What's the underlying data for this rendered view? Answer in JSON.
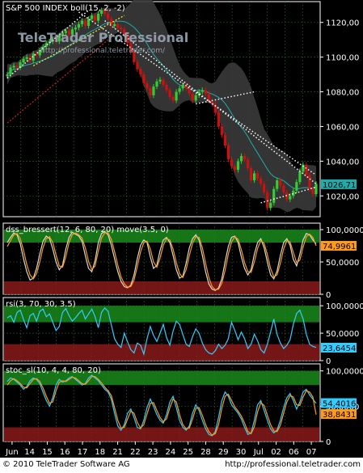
{
  "chart_data": [
    {
      "type": "candlestick",
      "title": "S&P 500 INDEX boll(15, 2, -2)",
      "watermark": "TeleTrader Professional",
      "watermark_url": "http://professional.teletrader.com/",
      "ylim": [
        1008,
        1132
      ],
      "yticks": [
        "1120,00",
        "1100,00",
        "1080,00",
        "1060,00",
        "1040,00",
        "1020,00"
      ],
      "ytick_values": [
        1120,
        1100,
        1080,
        1060,
        1040,
        1020
      ],
      "last_value": "1026,71",
      "last": 1026.71,
      "close": [
        1090,
        1094,
        1095,
        1094,
        1097,
        1099,
        1100,
        1098,
        1102,
        1101,
        1104,
        1106,
        1108,
        1109,
        1110,
        1109,
        1112,
        1114,
        1115,
        1113,
        1116,
        1117,
        1119,
        1121,
        1118,
        1122,
        1124,
        1121,
        1125,
        1127,
        1125,
        1122,
        1118,
        1119,
        1117,
        1116,
        1113,
        1108,
        1103,
        1097,
        1093,
        1090,
        1085,
        1082,
        1078,
        1083,
        1086,
        1087,
        1084,
        1081,
        1077,
        1075,
        1080,
        1082,
        1084,
        1082,
        1079,
        1075,
        1078,
        1080,
        1081,
        1079,
        1075,
        1073,
        1068,
        1060,
        1055,
        1049,
        1041,
        1037,
        1035,
        1040,
        1043,
        1041,
        1036,
        1029,
        1033,
        1030,
        1027,
        1022,
        1013,
        1016,
        1024,
        1029,
        1026,
        1022,
        1018,
        1020,
        1023,
        1028,
        1034,
        1038,
        1032,
        1024,
        1021,
        1027
      ]
    },
    {
      "type": "line",
      "title": "dss_bressert(12, 6, 80, 20) move(3.5, 0)",
      "ylim": [
        0,
        110
      ],
      "yticks": [
        "100,0000",
        "50,0000",
        "0"
      ],
      "ytick_values": [
        100,
        50,
        0
      ],
      "bands": [
        {
          "from": 80,
          "to": 100,
          "color": "#1a8a1a"
        },
        {
          "from": 0,
          "to": 20,
          "color": "#8a1a1a"
        }
      ],
      "series": [
        {
          "color": "#d9d9d9",
          "values": [
            80,
            88,
            95,
            92,
            78,
            55,
            35,
            22,
            25,
            40,
            62,
            82,
            90,
            86,
            70,
            50,
            38,
            45,
            70,
            88,
            96,
            93,
            90,
            82,
            60,
            40,
            35,
            52,
            80,
            94,
            97,
            92,
            76,
            55,
            35,
            20,
            12,
            10,
            14,
            30,
            55,
            76,
            84,
            80,
            58,
            40,
            45,
            68,
            84,
            88,
            80,
            60,
            38,
            25,
            28,
            48,
            72,
            86,
            92,
            84,
            60,
            35,
            16,
            8,
            6,
            10,
            24,
            50,
            74,
            88,
            90,
            80,
            58,
            40,
            30,
            38,
            62,
            80,
            86,
            72,
            50,
            30,
            24,
            36,
            60,
            80,
            86,
            76,
            54,
            44,
            62,
            84,
            94,
            92,
            84,
            78
          ]
        },
        {
          "color": "#ff9a1a",
          "values": [
            74,
            83,
            92,
            94,
            86,
            68,
            46,
            30,
            24,
            32,
            50,
            72,
            86,
            89,
            80,
            61,
            44,
            42,
            58,
            80,
            92,
            95,
            92,
            87,
            72,
            51,
            38,
            44,
            67,
            87,
            95,
            95,
            85,
            66,
            45,
            27,
            16,
            11,
            12,
            22,
            43,
            66,
            80,
            82,
            70,
            50,
            42,
            56,
            76,
            86,
            84,
            70,
            49,
            32,
            26,
            38,
            60,
            79,
            89,
            88,
            72,
            48,
            26,
            12,
            7,
            8,
            17,
            37,
            62,
            81,
            89,
            85,
            69,
            49,
            35,
            34,
            50,
            71,
            83,
            79,
            61,
            40,
            27,
            30,
            48,
            70,
            83,
            81,
            65,
            49,
            53,
            73,
            89,
            93,
            88,
            75
          ]
        }
      ],
      "last_labels": [
        {
          "text": "74,9961",
          "value": 74.9961,
          "color": "#ff9a1a"
        }
      ]
    },
    {
      "type": "line",
      "title": "rsi(3, 70, 30, 3.5)",
      "ylim": [
        0,
        115
      ],
      "yticks": [
        "100,0000",
        "50,0000",
        "0"
      ],
      "ytick_values": [
        100,
        50,
        0
      ],
      "bands": [
        {
          "from": 70,
          "to": 100,
          "color": "#1a8a1a"
        },
        {
          "from": 0,
          "to": 30,
          "color": "#8a1a1a"
        }
      ],
      "series": [
        {
          "color": "#33ccff",
          "values": [
            78,
            82,
            70,
            88,
            92,
            75,
            60,
            82,
            86,
            72,
            90,
            94,
            80,
            85,
            70,
            55,
            62,
            88,
            95,
            82,
            72,
            78,
            86,
            92,
            76,
            85,
            94,
            80,
            60,
            88,
            96,
            90,
            65,
            40,
            30,
            24,
            50,
            34,
            20,
            14,
            32,
            28,
            12,
            40,
            62,
            46,
            35,
            50,
            66,
            42,
            28,
            54,
            72,
            66,
            48,
            30,
            26,
            44,
            58,
            50,
            32,
            20,
            14,
            12,
            18,
            30,
            22,
            28,
            40,
            70,
            55,
            38,
            52,
            40,
            22,
            30,
            48,
            36,
            20,
            14,
            30,
            52,
            76,
            48,
            32,
            22,
            28,
            38,
            66,
            86,
            92,
            76,
            48,
            30,
            26,
            24
          ]
        }
      ],
      "last_labels": [
        {
          "text": "23,6454",
          "value": 23.6454,
          "color": "#33ccff"
        }
      ]
    },
    {
      "type": "line",
      "title": "stoc_sl(10, 4, 4, 80, 20)",
      "ylim": [
        0,
        110
      ],
      "yticks": [
        "100,0000",
        "50,0000",
        "0"
      ],
      "ytick_values": [
        100,
        50,
        0
      ],
      "bands": [
        {
          "from": 80,
          "to": 100,
          "color": "#1a8a1a"
        },
        {
          "from": 0,
          "to": 20,
          "color": "#8a1a1a"
        }
      ],
      "series": [
        {
          "color": "#33ccff",
          "values": [
            85,
            90,
            88,
            84,
            80,
            74,
            78,
            86,
            90,
            88,
            82,
            70,
            58,
            50,
            62,
            80,
            88,
            84,
            86,
            90,
            92,
            88,
            84,
            80,
            82,
            90,
            94,
            90,
            86,
            80,
            74,
            70,
            60,
            40,
            22,
            16,
            24,
            40,
            46,
            34,
            20,
            18,
            30,
            48,
            60,
            50,
            38,
            30,
            26,
            38,
            56,
            64,
            48,
            30,
            20,
            16,
            22,
            40,
            52,
            44,
            30,
            18,
            10,
            8,
            14,
            34,
            58,
            70,
            64,
            52,
            46,
            40,
            32,
            20,
            10,
            12,
            30,
            52,
            58,
            44,
            30,
            18,
            12,
            16,
            30,
            48,
            62,
            68,
            58,
            46,
            56,
            70,
            74,
            66,
            60,
            54
          ]
        },
        {
          "color": "#ff9a1a",
          "values": [
            80,
            86,
            89,
            86,
            82,
            77,
            76,
            82,
            88,
            89,
            85,
            76,
            64,
            54,
            56,
            72,
            84,
            86,
            85,
            88,
            91,
            90,
            86,
            82,
            81,
            86,
            92,
            92,
            88,
            83,
            77,
            72,
            65,
            48,
            30,
            19,
            20,
            32,
            43,
            40,
            27,
            19,
            24,
            39,
            54,
            55,
            44,
            34,
            28,
            32,
            48,
            60,
            56,
            38,
            24,
            18,
            19,
            32,
            47,
            48,
            37,
            24,
            14,
            9,
            11,
            24,
            47,
            64,
            67,
            58,
            49,
            43,
            36,
            26,
            14,
            11,
            21,
            42,
            55,
            51,
            37,
            24,
            15,
            14,
            23,
            40,
            56,
            65,
            63,
            52,
            51,
            63,
            72,
            70,
            63,
            38
          ]
        }
      ],
      "last_labels": [
        {
          "text": "54,4016",
          "value": 54.4016,
          "color": "#33ccff"
        },
        {
          "text": "38,8431",
          "value": 38.8431,
          "color": "#ff9a1a"
        }
      ]
    }
  ],
  "x_axis": {
    "labels": [
      "Jun",
      "14",
      "15",
      "16",
      "17",
      "18",
      "21",
      "22",
      "23",
      "24",
      "25",
      "28",
      "29",
      "30",
      "Jul",
      "02",
      "06",
      "07"
    ]
  },
  "footer": {
    "copyright": "© 2010 TeleTrader Software AG",
    "url": "http://professional.teletrader.com"
  },
  "colors": {
    "candle_up": "#33cc33",
    "candle_down": "#cc1111",
    "band_fill": "#3a3a3a",
    "middle_band": "#22aaaa",
    "grid": "#2f5f2f",
    "axis": "#ffffff"
  }
}
